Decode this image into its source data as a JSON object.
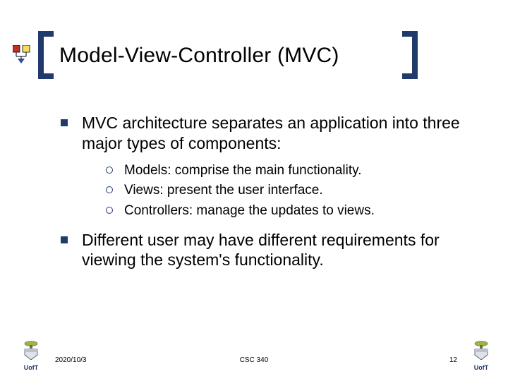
{
  "slide": {
    "title": "Model-View-Controller (MVC)",
    "bullets": [
      {
        "text": "MVC architecture separates an application into three major types of components:",
        "sub": [
          "Models: comprise the main functionality.",
          "Views: present the user interface.",
          "Controllers: manage the updates to views."
        ]
      },
      {
        "text": "Different user may have different requirements for viewing the system's functionality.",
        "sub": []
      }
    ]
  },
  "footer": {
    "date": "2020/10/3",
    "course": "CSC 340",
    "page": "12",
    "crest_label": "UofT"
  }
}
